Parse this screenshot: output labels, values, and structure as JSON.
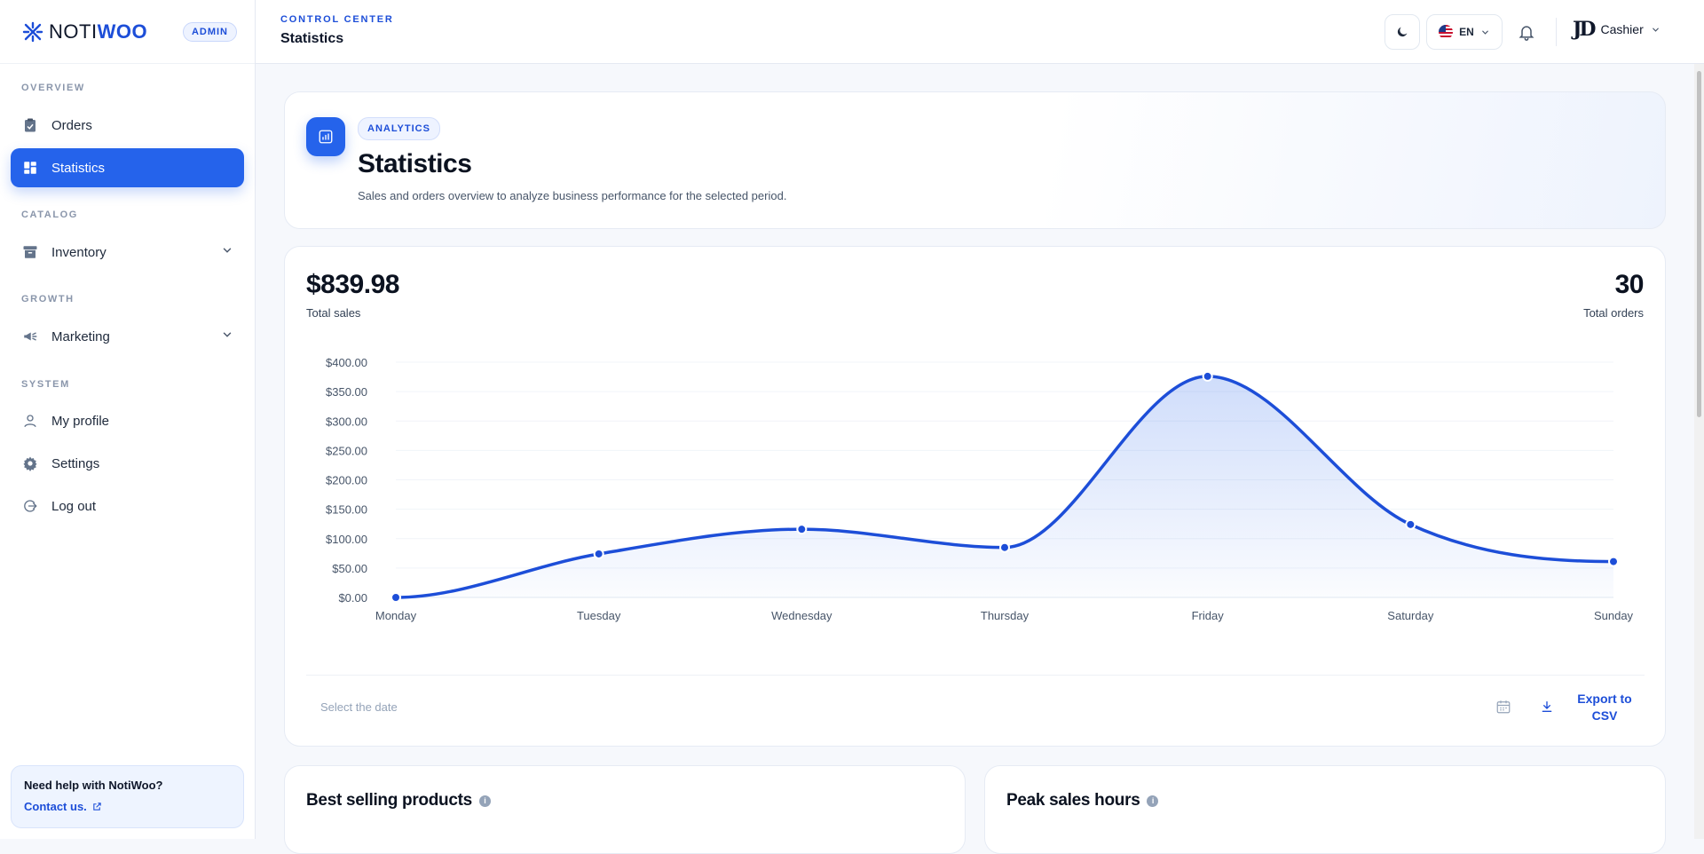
{
  "brand": {
    "name_light": "NOTI",
    "name_bold": "WOO",
    "badge": "ADMIN",
    "logo_icon": "puzzle-logo-icon"
  },
  "sidebar": {
    "sections": [
      "OVERVIEW",
      "CATALOG",
      "GROWTH",
      "SYSTEM"
    ],
    "items": [
      {
        "label": "Orders",
        "icon": "clipboard-icon",
        "active": false
      },
      {
        "label": "Statistics",
        "icon": "dashboard-icon",
        "active": true
      },
      {
        "label": "Inventory",
        "icon": "archive-icon",
        "expandable": true
      },
      {
        "label": "Marketing",
        "icon": "megaphone-icon",
        "expandable": true
      },
      {
        "label": "My profile",
        "icon": "user-icon"
      },
      {
        "label": "Settings",
        "icon": "gear-icon"
      },
      {
        "label": "Log out",
        "icon": "logout-icon"
      }
    ],
    "help": {
      "title": "Need help with NotiWoo?",
      "link": "Contact us."
    }
  },
  "header": {
    "kicker": "CONTROL CENTER",
    "title": "Statistics",
    "language": "EN",
    "user_initials": "JD",
    "user_name": "Cashier"
  },
  "hero": {
    "badge": "ANALYTICS",
    "title": "Statistics",
    "subtitle": "Sales and orders overview to analyze business performance for the selected period."
  },
  "kpis": {
    "total_sales_value": "$839.98",
    "total_sales_label": "Total sales",
    "total_orders_value": "30",
    "total_orders_label": "Total orders"
  },
  "chart_data": {
    "type": "area",
    "categories": [
      "Monday",
      "Tuesday",
      "Wednesday",
      "Thursday",
      "Friday",
      "Saturday",
      "Sunday"
    ],
    "series": [
      {
        "values": [
          0,
          74,
          116,
          85,
          376,
          124,
          61
        ]
      }
    ],
    "ylim": [
      0,
      400
    ],
    "yticks": [
      "$0.00",
      "$50.00",
      "$100.00",
      "$150.00",
      "$200.00",
      "$250.00",
      "$300.00",
      "$350.00",
      "$400.00"
    ],
    "grid": true,
    "color": "#1d4ed8"
  },
  "filters": {
    "date_placeholder": "Select the date",
    "export_label": "Export to CSV"
  },
  "cards": {
    "best_selling": "Best selling products",
    "peak_hours": "Peak sales hours"
  }
}
